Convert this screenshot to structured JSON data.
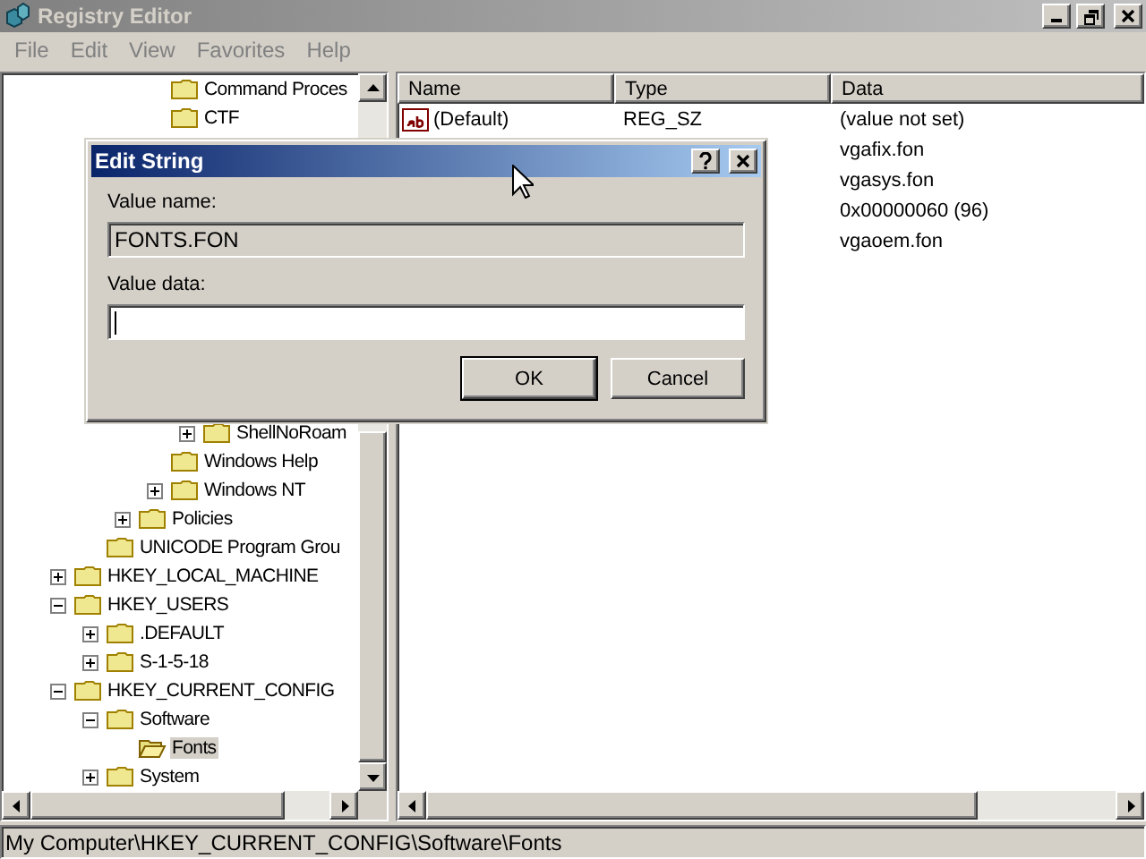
{
  "window": {
    "title": "Registry Editor",
    "active": false
  },
  "menu": [
    {
      "label": "File",
      "disabled": true
    },
    {
      "label": "Edit",
      "disabled": true
    },
    {
      "label": "View",
      "disabled": true
    },
    {
      "label": "Favorites",
      "disabled": true
    },
    {
      "label": "Help",
      "disabled": true
    }
  ],
  "tree": [
    {
      "children": [
        {
          "children": [
            {
              "children": [
                {
                  "label": "Command Proces",
                  "selected": false
                },
                {
                  "label": "CTF",
                  "selected": false
                },
                {
                  "children": [
                    {
                      "label": "ShellNoRoam",
                      "expanded": false,
                      "selected": false
                    }
                  ]
                },
                {
                  "label": "Windows Help",
                  "selected": false
                },
                {
                  "label": "Windows NT",
                  "expanded": false,
                  "selected": false
                }
              ]
            },
            {
              "label": "Policies",
              "expanded": false,
              "selected": false
            }
          ]
        },
        {
          "label": "UNICODE Program Grou",
          "selected": false
        }
      ]
    },
    {
      "label": "HKEY_LOCAL_MACHINE",
      "expanded": false,
      "selected": false
    },
    {
      "label": "HKEY_USERS",
      "expanded": true,
      "selected": false,
      "children": [
        {
          "label": ".DEFAULT",
          "expanded": false,
          "selected": false
        },
        {
          "label": "S-1-5-18",
          "expanded": false,
          "selected": false
        }
      ]
    },
    {
      "label": "HKEY_CURRENT_CONFIG",
      "expanded": true,
      "selected": false,
      "children": [
        {
          "label": "Software",
          "expanded": true,
          "selected": false,
          "children": [
            {
              "label": "Fonts",
              "selected": true
            }
          ]
        },
        {
          "label": "System",
          "expanded": false,
          "selected": false
        }
      ]
    }
  ],
  "list": {
    "columns": [
      "Name",
      "Type",
      "Data"
    ],
    "rows": [
      {
        "kind": "string",
        "name": "(Default)",
        "type": "REG_SZ",
        "data": "(value not set)"
      },
      {
        "data": "vgafix.fon"
      },
      {
        "data": "vgasys.fon"
      },
      {
        "data": "0x00000060 (96)"
      },
      {
        "data": "vgaoem.fon"
      }
    ]
  },
  "dialog": {
    "title": "Edit String",
    "fields": [
      {
        "label": "Value name:",
        "value": "FONTS.FON",
        "disabled": true,
        "focused": false
      },
      {
        "label": "Value data:",
        "disabled": false,
        "focused": true
      }
    ],
    "buttons": [
      {
        "label": "OK",
        "default": true
      },
      {
        "label": "Cancel",
        "default": false
      }
    ]
  },
  "status_bar": "My Computer\\HKEY_CURRENT_CONFIG\\Software\\Fonts"
}
